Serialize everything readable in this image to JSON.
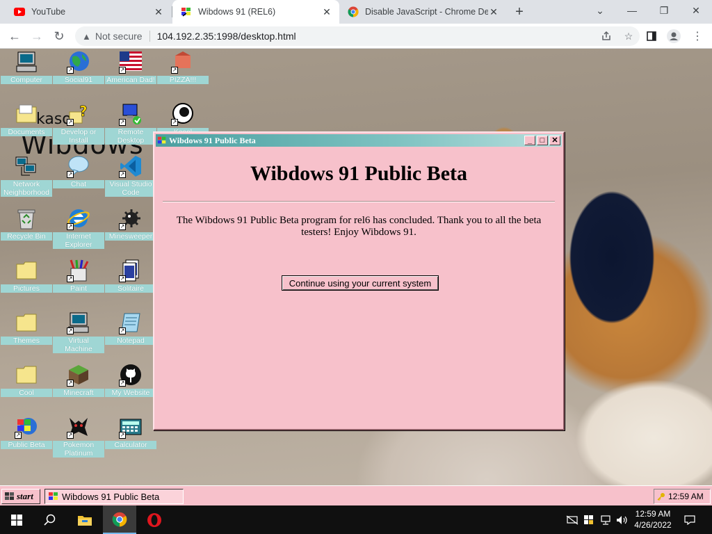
{
  "browser": {
    "tabs": [
      {
        "label": "YouTube",
        "icon": "youtube-icon"
      },
      {
        "label": "Wibdows 91 (REL6)",
        "icon": "wibdows-icon"
      },
      {
        "label": "Disable JavaScript - Chrome Deve",
        "icon": "chrome-icon"
      }
    ],
    "address": {
      "security_label": "Not secure",
      "url": "104.192.2.35:1998/desktop.html"
    }
  },
  "desktop": {
    "background_text_1": "kaso",
    "background_text_2": "Wibdows",
    "icons": [
      {
        "label": "Computer"
      },
      {
        "label": "Social91"
      },
      {
        "label": "American Dad!"
      },
      {
        "label": "PIZZA!!!"
      },
      {
        "label": "Documents"
      },
      {
        "label": "Develop or Install"
      },
      {
        "label": "Remote Desktop"
      },
      {
        "label": "Kasol"
      },
      {
        "label": "Network Neighborhood"
      },
      {
        "label": "Chat"
      },
      {
        "label": "Visual Studio Code"
      },
      {
        "label": "Recycle Bin"
      },
      {
        "label": "Internet Explorer"
      },
      {
        "label": "Minesweeper"
      },
      {
        "label": "Pictures"
      },
      {
        "label": "Paint"
      },
      {
        "label": "Solitaire"
      },
      {
        "label": "Themes"
      },
      {
        "label": "Virtual Machine"
      },
      {
        "label": "Notepad"
      },
      {
        "label": "Cool"
      },
      {
        "label": "Minecraft"
      },
      {
        "label": "My Website"
      },
      {
        "label": "Public Beta"
      },
      {
        "label": "Pokemon Platinum"
      },
      {
        "label": "Calculator"
      }
    ]
  },
  "window": {
    "title": "Wibdows 91 Public Beta",
    "heading": "Wibdows 91 Public Beta",
    "message": "The Wibdows 91 Public Beta program for rel6 has concluded. Thank you to all the beta testers! Enjoy Wibdows 91.",
    "button_label": "Continue using your current system",
    "minimize": "_",
    "maximize": "□",
    "close": "✕"
  },
  "w91_taskbar": {
    "start_label": "start",
    "task_label": "Wibdows 91 Public Beta",
    "clock": "12:59 AM"
  },
  "os_taskbar": {
    "time": "12:59 AM",
    "date": "4/26/2022"
  },
  "colors": {
    "window_bg": "#f7c1cb",
    "title_gradient_start": "#4a9fa0",
    "icon_label_bg": "#9fd6d4",
    "os_taskbar": "#101010"
  }
}
